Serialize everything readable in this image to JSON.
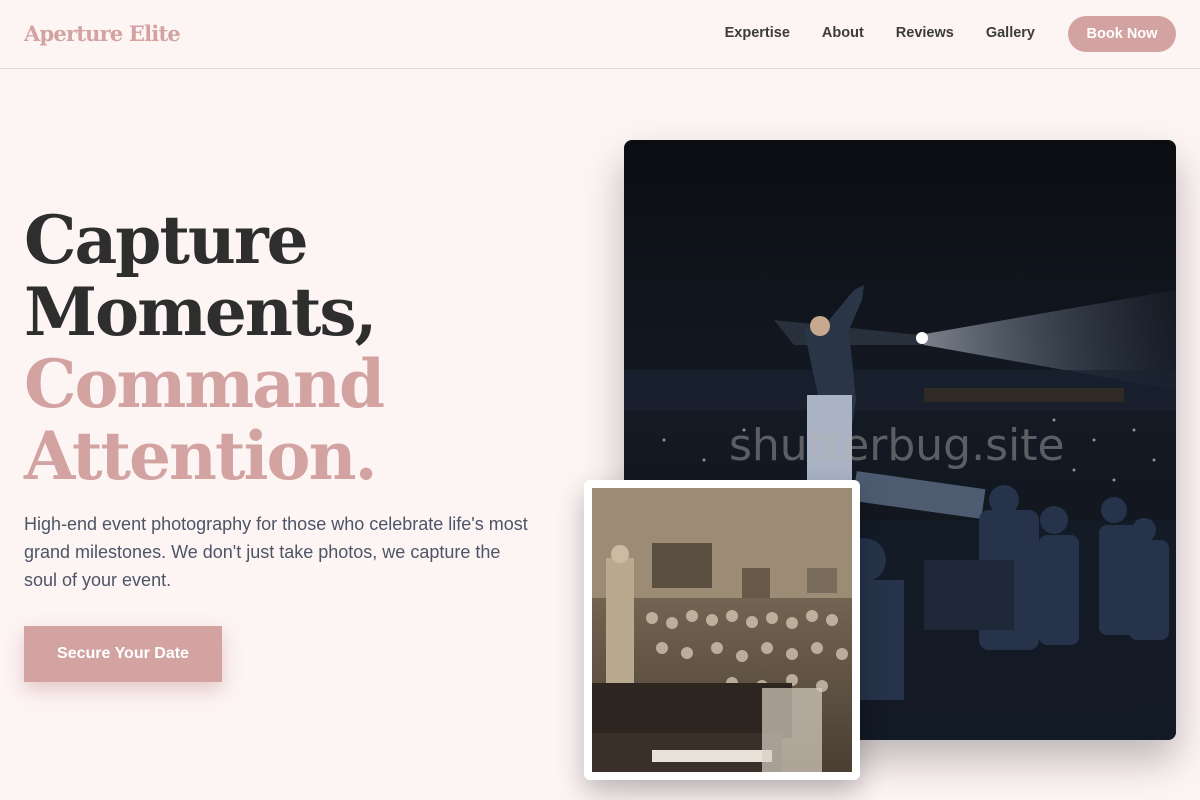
{
  "brand": {
    "name": "Aperture Elite",
    "accent": "#d3a3a2"
  },
  "nav": {
    "links": [
      "Expertise",
      "About",
      "Reviews",
      "Gallery"
    ],
    "cta": "Book Now"
  },
  "hero": {
    "title_dark": [
      "Capture",
      "Moments,"
    ],
    "title_accent": [
      "Command",
      "Attention."
    ],
    "subtitle": "High-end event photography for those who celebrate life's most grand milestones. We don't just take photos, we capture the soul of your event.",
    "cta": "Secure Your Date"
  },
  "images": {
    "main": {
      "subject": "concert-stage-performer",
      "watermark": "shutterbug.site"
    },
    "inset": {
      "subject": "vintage-sepia-hall-crowd"
    }
  }
}
